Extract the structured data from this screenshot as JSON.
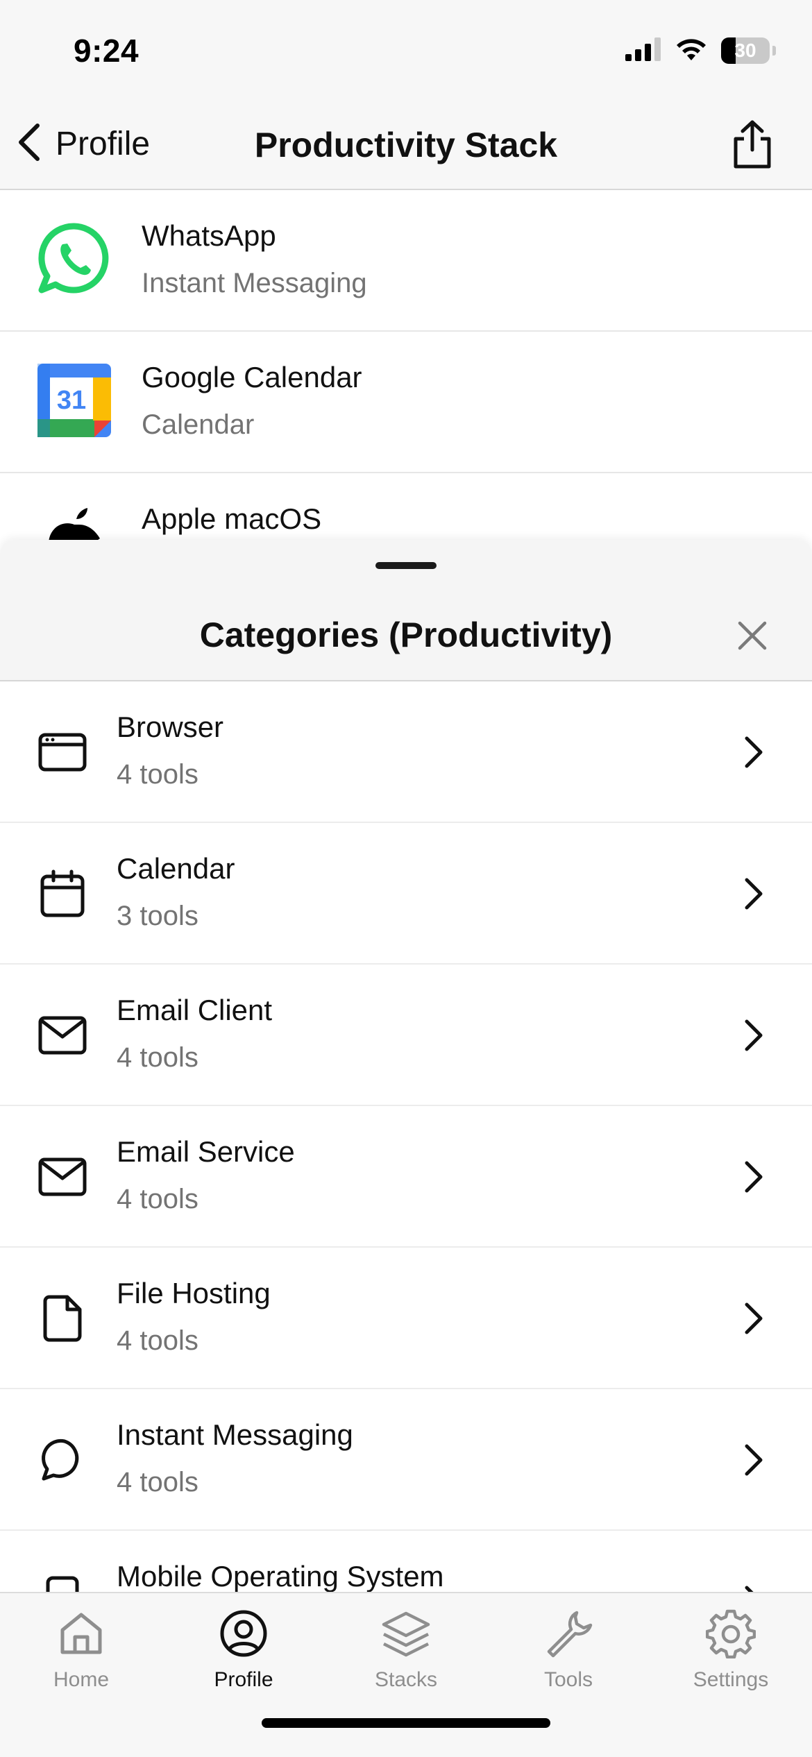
{
  "status_bar": {
    "time": "9:24",
    "battery_level": "30"
  },
  "header": {
    "back_label": "Profile",
    "title": "Productivity Stack"
  },
  "tools": [
    {
      "name": "WhatsApp",
      "category": "Instant Messaging",
      "icon": "whatsapp-logo"
    },
    {
      "name": "Google Calendar",
      "category": "Calendar",
      "icon": "google-calendar-logo",
      "icon_text": "31"
    },
    {
      "name": "Apple macOS",
      "category": "",
      "icon": "apple-logo"
    }
  ],
  "sheet": {
    "title": "Categories (Productivity)",
    "categories": [
      {
        "name": "Browser",
        "count": "4 tools",
        "icon": "browser-icon"
      },
      {
        "name": "Calendar",
        "count": "3 tools",
        "icon": "calendar-icon"
      },
      {
        "name": "Email Client",
        "count": "4 tools",
        "icon": "mail-icon"
      },
      {
        "name": "Email Service",
        "count": "4 tools",
        "icon": "mail-icon"
      },
      {
        "name": "File Hosting",
        "count": "4 tools",
        "icon": "file-icon"
      },
      {
        "name": "Instant Messaging",
        "count": "4 tools",
        "icon": "chat-bubble-icon"
      },
      {
        "name": "Mobile Operating System",
        "count": "",
        "icon": "phone-icon"
      }
    ]
  },
  "tab_bar": {
    "tabs": [
      {
        "label": "Home",
        "icon": "home-icon",
        "active": false
      },
      {
        "label": "Profile",
        "icon": "profile-icon",
        "active": true
      },
      {
        "label": "Stacks",
        "icon": "stacks-icon",
        "active": false
      },
      {
        "label": "Tools",
        "icon": "wrench-icon",
        "active": false
      },
      {
        "label": "Settings",
        "icon": "gear-icon",
        "active": false
      }
    ]
  },
  "colors": {
    "whatsapp_green": "#25D366",
    "gcal_blue": "#4285F4",
    "gcal_red": "#EA4335",
    "gcal_yellow": "#FBBC04",
    "gcal_green": "#34A853",
    "active_tab": "#111111",
    "inactive_tab": "#8e8e8e"
  }
}
